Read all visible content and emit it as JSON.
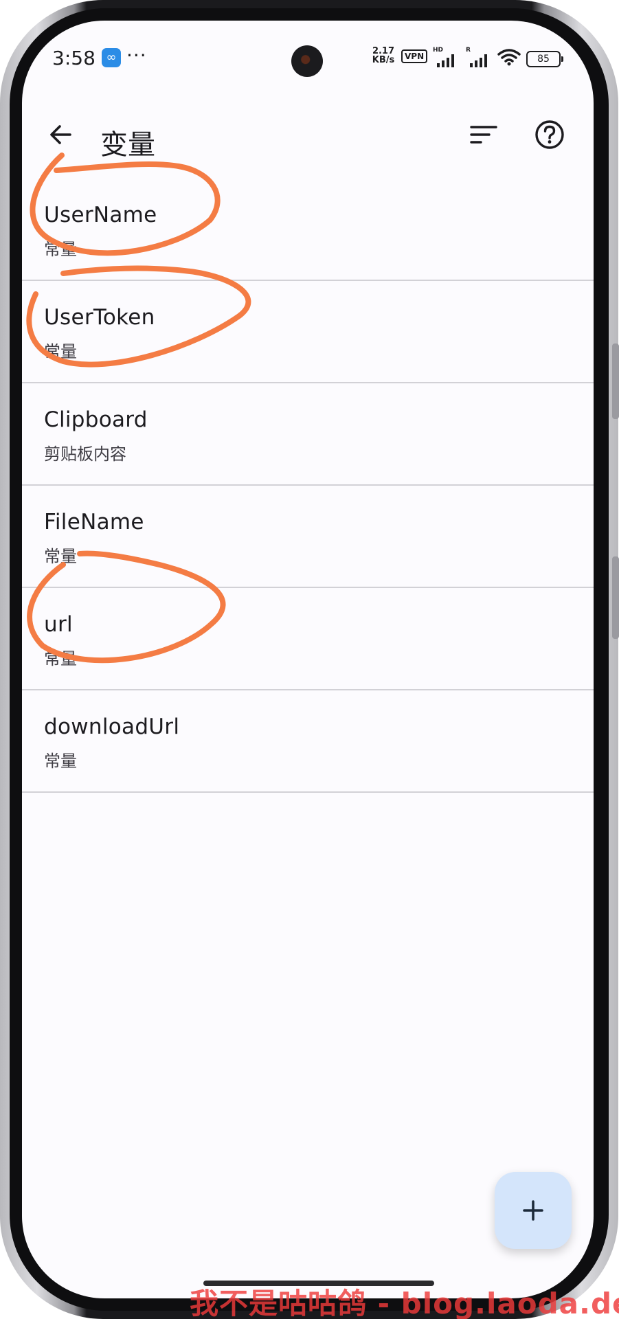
{
  "status_bar": {
    "time": "3:58",
    "more": "···",
    "net_speed_value": "2.17",
    "net_speed_unit": "KB/s",
    "vpn": "VPN",
    "sim1_tag": "HD",
    "sim2_tag": "R",
    "battery": "85"
  },
  "app_bar": {
    "title": "变量"
  },
  "variables": [
    {
      "name": "UserName",
      "type": "常量",
      "circled": true
    },
    {
      "name": "UserToken",
      "type": "常量",
      "circled": true
    },
    {
      "name": "Clipboard",
      "type": "剪贴板内容",
      "circled": false
    },
    {
      "name": "FileName",
      "type": "常量",
      "circled": false
    },
    {
      "name": "url",
      "type": "常量",
      "circled": true
    },
    {
      "name": "downloadUrl",
      "type": "常量",
      "circled": false
    }
  ],
  "fab": {
    "icon": "add-icon"
  },
  "watermark": "我不是咕咕鸽 - blog.laoda.de",
  "colors": {
    "screen_bg": "#fcfbfe",
    "divider": "#d2d1d6",
    "fab_bg": "#d4e5fb",
    "annotation": "#f47c44",
    "watermark": "#ee3a3a"
  }
}
